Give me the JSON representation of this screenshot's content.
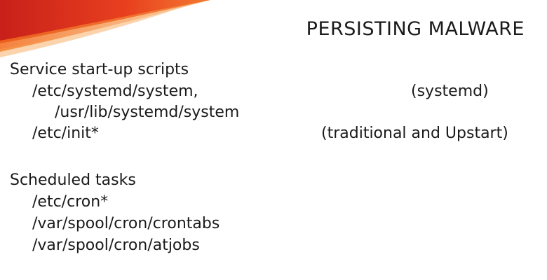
{
  "slide": {
    "title": "PERSISTING MALWARE",
    "accent_colors": [
      "#d9261c",
      "#f26a1b",
      "#f7a04a"
    ],
    "sections": [
      {
        "heading": "Service start-up scripts",
        "entries": [
          {
            "path": "/etc/systemd/system,",
            "note": "(systemd)"
          },
          {
            "path": "/usr/lib/systemd/system"
          },
          {
            "path": "/etc/init*",
            "note": "(traditional and Upstart)"
          }
        ]
      },
      {
        "heading": "Scheduled tasks",
        "entries": [
          {
            "path": "/etc/cron*"
          },
          {
            "path": "/var/spool/cron/crontabs"
          },
          {
            "path": "/var/spool/cron/atjobs"
          }
        ]
      }
    ]
  }
}
